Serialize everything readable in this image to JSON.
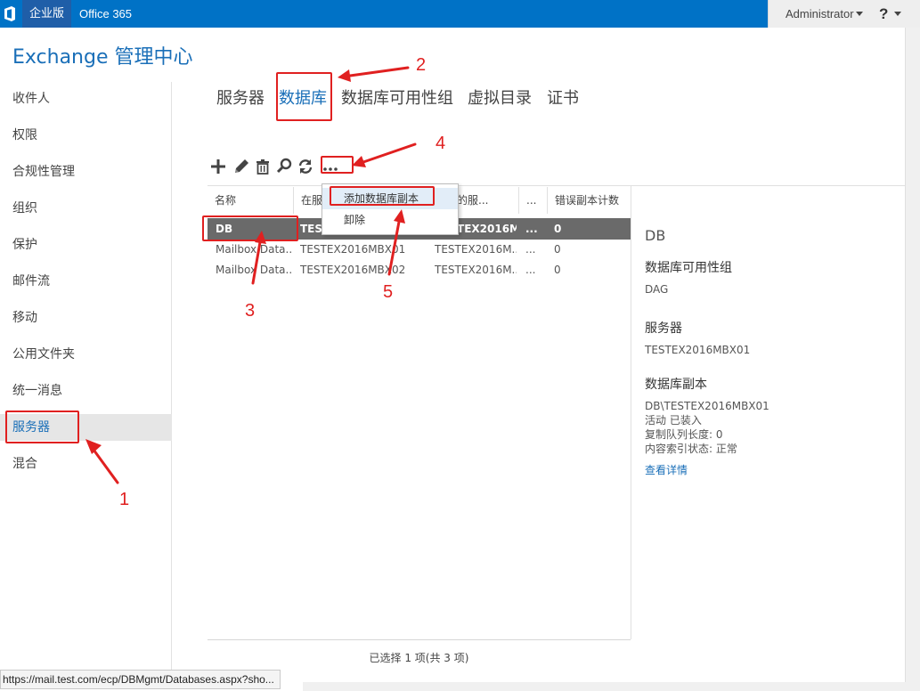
{
  "topbar": {
    "edition": "企业版",
    "office": "Office 365",
    "user": "Administrator",
    "help": "?"
  },
  "app_title": "Exchange 管理中心",
  "nav": {
    "items": [
      "收件人",
      "权限",
      "合规性管理",
      "组织",
      "保护",
      "邮件流",
      "移动",
      "公用文件夹",
      "统一消息",
      "服务器",
      "混合"
    ],
    "active": "服务器"
  },
  "tabs": [
    "服务器",
    "数据库",
    "数据库可用性组",
    "虚拟目录",
    "证书"
  ],
  "active_tab": "数据库",
  "toolbar": {
    "icons": [
      "add-icon",
      "edit-icon",
      "delete-icon",
      "search-icon",
      "refresh-icon",
      "more-icon"
    ],
    "more_label": "..."
  },
  "table": {
    "headers": [
      "名称",
      "在服",
      "副本的服...",
      "...",
      "错误副本计数"
    ],
    "rows": [
      {
        "name": "DB",
        "server": "TESTEX2016MBX01",
        "copy_server": "TESTEX2016M...",
        "dots": "...",
        "errors": "0"
      },
      {
        "name": "Mailbox Data...",
        "server": "TESTEX2016MBX01",
        "copy_server": "TESTEX2016M...",
        "dots": "...",
        "errors": "0"
      },
      {
        "name": "Mailbox Data...",
        "server": "TESTEX2016MBX02",
        "copy_server": "TESTEX2016M...",
        "dots": "...",
        "errors": "0"
      }
    ],
    "selected_row": 0,
    "status": "已选择 1 项(共 3 项)"
  },
  "context_menu": {
    "items": [
      "添加数据库副本",
      "卸除"
    ]
  },
  "details": {
    "title": "DB",
    "dag_label": "数据库可用性组",
    "dag_value": "DAG",
    "server_label": "服务器",
    "server_value": "TESTEX2016MBX01",
    "copies_label": "数据库副本",
    "copy_name": "DB\\TESTEX2016MBX01",
    "copy_status": "活动 已装入",
    "copy_queue": "复制队列长度: 0",
    "copy_index": "内容索引状态: 正常",
    "view_details": "查看详情"
  },
  "url_tooltip": "https://mail.test.com/ecp/DBMgmt/Databases.aspx?sho...",
  "annotations": [
    "1",
    "2",
    "3",
    "4",
    "5"
  ],
  "colors": {
    "brand_blue": "#0072c6",
    "accent": "#1a6fb8",
    "annotation_red": "#e02020",
    "selected_row": "#6a6a6a"
  }
}
